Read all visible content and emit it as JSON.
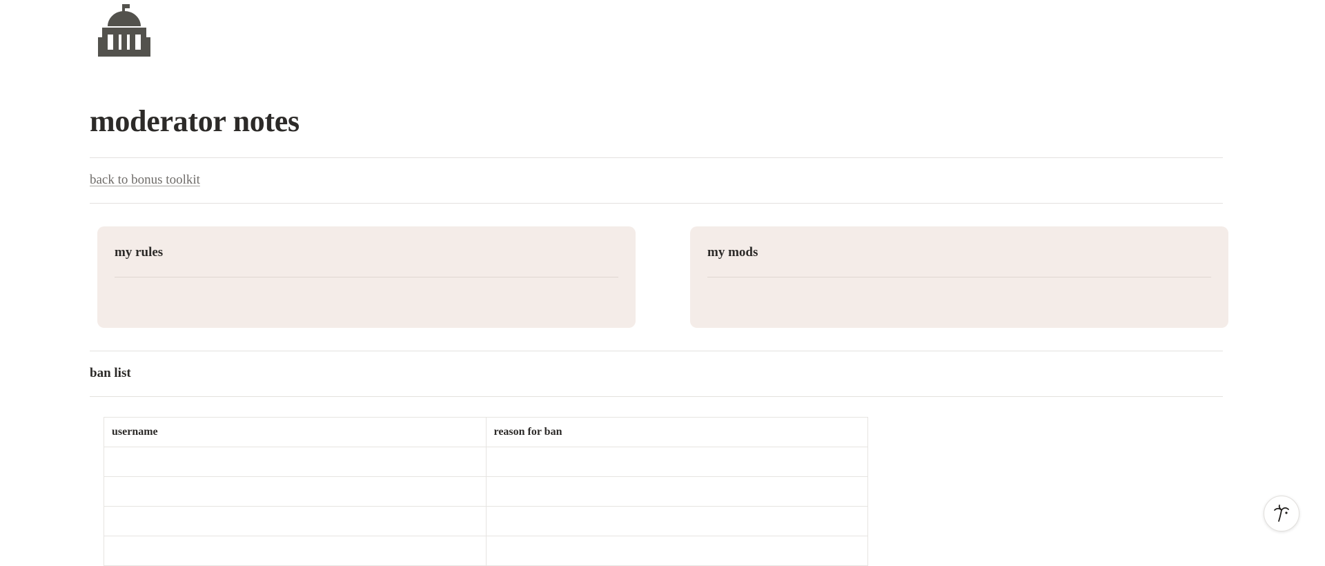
{
  "page": {
    "icon": "government-building-icon",
    "title": "moderator notes",
    "back_link": "back to bonus toolkit"
  },
  "cards": {
    "rules": {
      "title": "my rules"
    },
    "mods": {
      "title": "my mods"
    }
  },
  "ban_list": {
    "heading": "ban list",
    "columns": [
      "username",
      "reason for ban"
    ],
    "rows": [
      [
        "",
        ""
      ],
      [
        "",
        ""
      ],
      [
        "",
        ""
      ],
      [
        "",
        ""
      ]
    ]
  },
  "help_button": {
    "icon": "palm-tree-help-icon"
  },
  "colors": {
    "icon": "#53524d",
    "card_background": "#f4ece8",
    "text": "#2c2a28",
    "link": "#6f6c69"
  }
}
